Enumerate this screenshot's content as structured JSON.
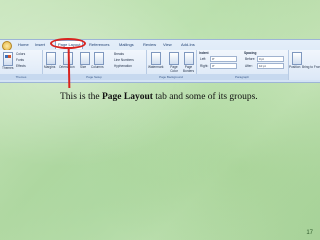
{
  "ribbon": {
    "tabs": [
      "Home",
      "Insert",
      "Page Layout",
      "References",
      "Mailings",
      "Review",
      "View",
      "Add-Ins"
    ],
    "active_tab": "Page Layout",
    "themes_group": {
      "label": "Themes",
      "items": [
        "Themes",
        "Colors",
        "Fonts",
        "Effects"
      ]
    },
    "page_setup_group": {
      "label": "Page Setup",
      "items": [
        "Margins",
        "Orientation",
        "Size",
        "Columns",
        "Breaks",
        "Line Numbers",
        "Hyphenation"
      ]
    },
    "page_background_group": {
      "label": "Page Background",
      "items": [
        "Watermark",
        "Page Color",
        "Page Borders"
      ]
    },
    "paragraph_group": {
      "label": "Paragraph",
      "indent_label": "Indent",
      "left_label": "Left:",
      "left_value": "0\"",
      "right_label": "Right:",
      "right_value": "0\"",
      "spacing_label": "Spacing",
      "before_label": "Before:",
      "before_value": "0 pt",
      "after_label": "After:",
      "after_value": "10 pt"
    },
    "arrange_group": {
      "items": [
        "Position",
        "Bring to Front"
      ]
    }
  },
  "caption": {
    "prefix": "This is the ",
    "bold": "Page Layout",
    "suffix": " tab and some of its groups."
  },
  "slide_number": "17",
  "colors": {
    "highlight": "#d8231f",
    "ribbon": "#dce8f7",
    "background": "#b8dcaa"
  }
}
